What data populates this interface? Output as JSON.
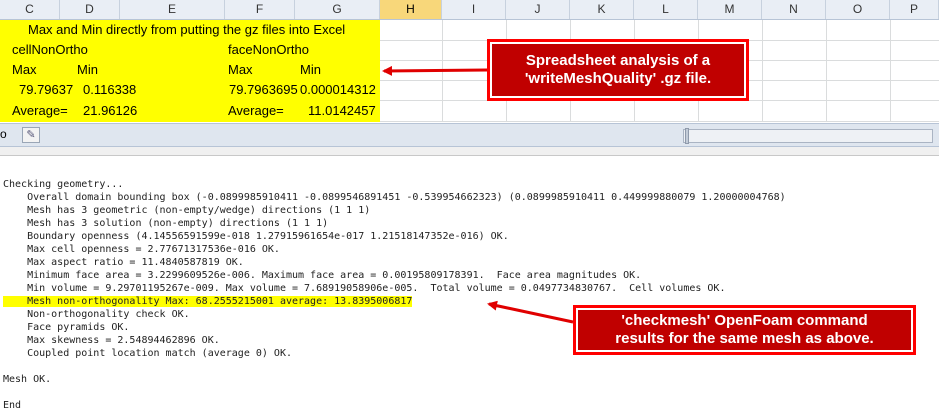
{
  "spreadsheet": {
    "columns": [
      "C",
      "D",
      "E",
      "F",
      "G",
      "H",
      "I",
      "J",
      "K",
      "L",
      "M",
      "N",
      "O",
      "P"
    ],
    "selected_column": "H",
    "title": "Max and Min directly from putting the gz files into Excel",
    "left_label": "cellNonOrtho",
    "right_label": "faceNonOrtho",
    "max_label": "Max",
    "min_label": "Min",
    "left_max": "79.79637",
    "left_min": "0.116338",
    "right_max": "79.7963695",
    "right_min": "0.000014312",
    "avg_label": "Average=",
    "left_avg": "21.96126",
    "right_avg": "11.0142457",
    "sheet_tab_stub": "o",
    "highlight_color": "#ffff00"
  },
  "console": {
    "lines": [
      "Checking geometry...",
      "    Overall domain bounding box (-0.0899985910411 -0.0899546891451 -0.539954662323) (0.0899985910411 0.449999880079 1.20000004768)",
      "    Mesh has 3 geometric (non-empty/wedge) directions (1 1 1)",
      "    Mesh has 3 solution (non-empty) directions (1 1 1)",
      "    Boundary openness (4.14556591599e-018 1.27915961654e-017 1.21518147352e-016) OK.",
      "    Max cell openness = 2.77671317536e-016 OK.",
      "    Max aspect ratio = 11.4840587819 OK.",
      "    Minimum face area = 3.2299609526e-006. Maximum face area = 0.00195809178391.  Face area magnitudes OK.",
      "    Min volume = 9.29701195267e-009. Max volume = 7.68919058906e-005.  Total volume = 0.0497734830767.  Cell volumes OK.",
      "    Mesh non-orthogonality Max: 68.2555215001 average: 13.8395006817",
      "    Non-orthogonality check OK.",
      "    Face pyramids OK.",
      "    Max skewness = 2.54894462896 OK.",
      "    Coupled point location match (average 0) OK.",
      "",
      "Mesh OK.",
      "",
      "End"
    ],
    "highlighted_line_index": 9
  },
  "callouts": {
    "top_line1": "Spreadsheet analysis of a",
    "top_line2": "'writeMeshQuality' .gz file.",
    "bottom_line1": "'checkmesh' OpenFoam command",
    "bottom_line2": "results for the same mesh as above.",
    "color": "#c00000"
  }
}
